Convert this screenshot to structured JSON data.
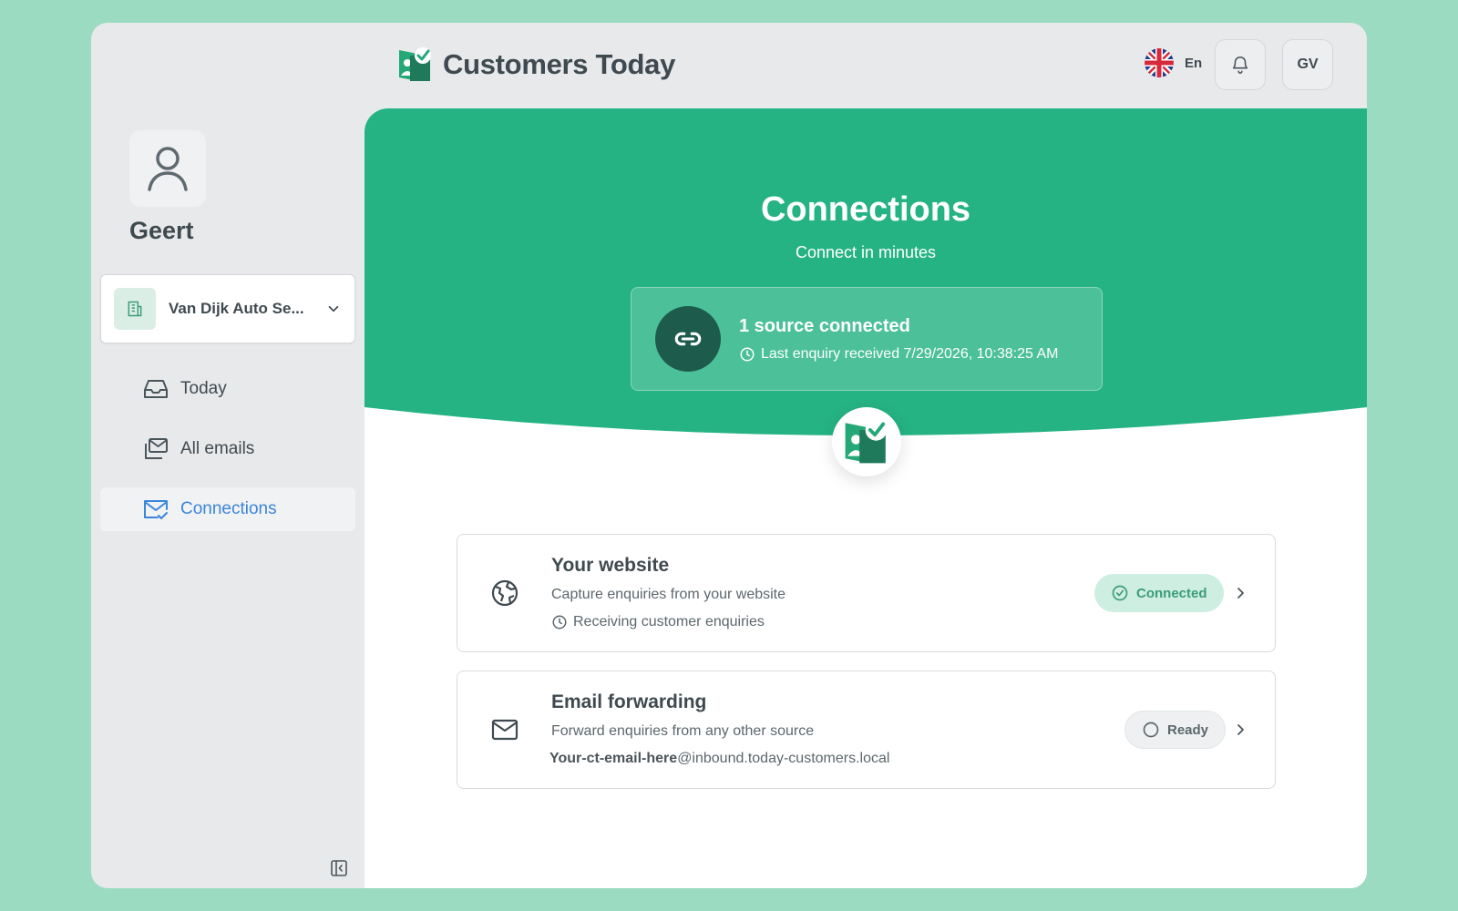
{
  "app": {
    "title": "Customers Today"
  },
  "header": {
    "language": "En",
    "avatar_initials": "GV"
  },
  "sidebar": {
    "user_name": "Geert",
    "workspace": "Van Dijk Auto Se...",
    "items": [
      {
        "label": "Today",
        "icon": "inbox-icon"
      },
      {
        "label": "All emails",
        "icon": "mail-stack-icon"
      },
      {
        "label": "Connections",
        "icon": "mail-check-icon",
        "active": true
      }
    ]
  },
  "hero": {
    "title": "Connections",
    "subtitle": "Connect in minutes",
    "status_title": "1 source connected",
    "status_meta": "Last enquiry received 7/29/2026, 10:38:25 AM"
  },
  "connections": [
    {
      "title": "Your website",
      "description": "Capture enquiries from your website",
      "detail": "Receiving customer enquiries",
      "status": "Connected",
      "icon": "globe-icon"
    },
    {
      "title": "Email forwarding",
      "description": "Forward enquiries from any other source",
      "address_prefix": "Your-ct-email-here",
      "address_domain": "@inbound.today-customers.local",
      "status": "Ready",
      "icon": "envelope-icon"
    }
  ],
  "colors": {
    "brand_green": "#25b383",
    "dark_green": "#1d5c4c",
    "page_background": "#9bdbc1",
    "active_nav": "#3b86d9"
  }
}
